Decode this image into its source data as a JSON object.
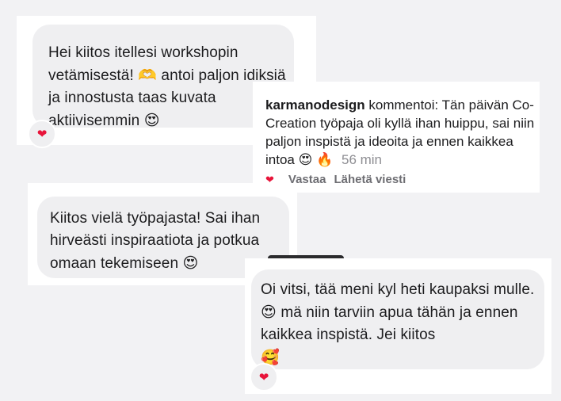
{
  "messages": {
    "msg1": {
      "text_before_emoji": "Hei kiitos itellesi workshopin vetämisestä!",
      "emoji1": "🫶",
      "text_after_emoji": "antoi paljon idiksiä ja innostusta taas kuvata aktiivisemmin",
      "emoji2": "😍",
      "reaction": "❤"
    },
    "comment": {
      "username": "karmanodesign",
      "text": "kommentoi: Tän päivän Co-Creation työpaja oli kyllä ihan huippu, sai niin paljon inspistä ja ideoita ja ennen kaikkea intoa",
      "emoji1": "😍",
      "emoji2": "🔥",
      "time": "56 min",
      "like_icon": "❤",
      "reply_label": "Vastaa",
      "send_label": "Lähetä viesti"
    },
    "msg2": {
      "text": "Kiitos vielä työpajasta! Sai ihan hirveästi inspiraatiota ja potkua omaan tekemiseen",
      "emoji1": "😍"
    },
    "msg3": {
      "text_before_emoji": "Oi vitsi, tää meni kyl heti kaupaksi mulle.",
      "emoji1": "😍",
      "text_after_emoji": "mä niin tarviin apua tähän ja ennen kaikkea inspistä. Jei kiitos",
      "emoji2": "🥰",
      "reaction": "❤"
    }
  },
  "colors": {
    "background": "#f2f2f4",
    "bubble": "#efeff1",
    "heart": "#e8143a",
    "muted_text": "#8e8e93"
  }
}
